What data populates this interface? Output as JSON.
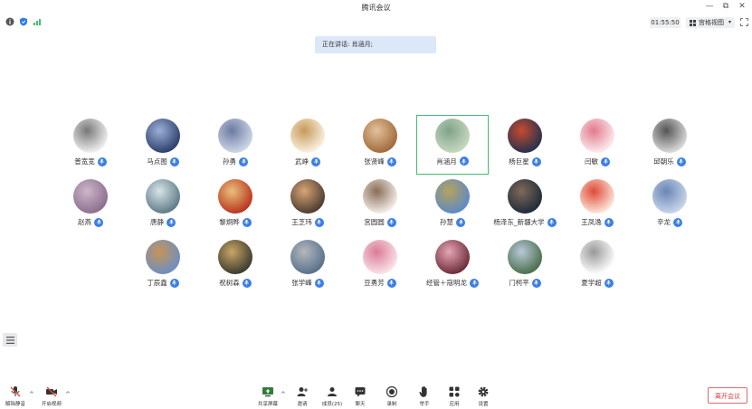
{
  "window": {
    "title": "腾讯会议",
    "minimize": "—",
    "restore": "⧉",
    "close": "✕"
  },
  "status": {
    "timer": "01:55:50",
    "grid_view_label": "宫格视图"
  },
  "speaking": {
    "text": "正在讲话: 肖涵月;"
  },
  "participants": [
    {
      "name": "普宽宽",
      "avatar": "totoro-avatar",
      "colors": [
        "#f2f2f2",
        "#777777"
      ]
    },
    {
      "name": "马点图",
      "avatar": "girl-photo-avatar",
      "colors": [
        "#2c3e6b",
        "#9bb0d8"
      ]
    },
    {
      "name": "孙勇",
      "avatar": "anime-avatar",
      "colors": [
        "#cfd8e8",
        "#6c7aa1"
      ]
    },
    {
      "name": "武峥",
      "avatar": "cartoon-dog-avatar",
      "colors": [
        "#fbf3e4",
        "#c79a5a"
      ]
    },
    {
      "name": "张贤峰",
      "avatar": "bear-avatar",
      "colors": [
        "#a06a3a",
        "#e2c19b"
      ]
    },
    {
      "name": "肖涵月",
      "avatar": "painting-avatar",
      "colors": [
        "#c8d8c0",
        "#7fa38a"
      ]
    },
    {
      "name": "杨巨星",
      "avatar": "dark-landscape-avatar",
      "colors": [
        "#25314d",
        "#c64a2f"
      ]
    },
    {
      "name": "闫敏",
      "avatar": "cartoon-girl-avatar",
      "colors": [
        "#fbeef0",
        "#e37a8d"
      ]
    },
    {
      "name": "邱朝乐",
      "avatar": "forest-avatar",
      "colors": [
        "#dcdcdc",
        "#555555"
      ]
    },
    {
      "name": "赵燕",
      "avatar": "anime-girl-avatar",
      "colors": [
        "#8b6e8f",
        "#cdb6c9"
      ]
    },
    {
      "name": "唐静",
      "avatar": "seal-avatar",
      "colors": [
        "#5e7a86",
        "#d7e4e8"
      ]
    },
    {
      "name": "黎炯晔",
      "avatar": "tiger-avatar",
      "colors": [
        "#b8331e",
        "#e9c07a"
      ]
    },
    {
      "name": "王芝玮",
      "avatar": "girl-avatar",
      "colors": [
        "#4a3b30",
        "#d9a574"
      ]
    },
    {
      "name": "宫圆圆",
      "avatar": "sketch-girl-avatar",
      "colors": [
        "#f5f0ea",
        "#8a6c58"
      ]
    },
    {
      "name": "孙慧",
      "avatar": "grassland-avatar",
      "colors": [
        "#5c89c9",
        "#b6a35a"
      ]
    },
    {
      "name": "杨泽东_新疆大学",
      "avatar": "man-photo-avatar",
      "colors": [
        "#1e2a3a",
        "#7e6a58"
      ]
    },
    {
      "name": "王凤逸",
      "avatar": "crayon-avatar",
      "colors": [
        "#fbe9dc",
        "#e04a3a"
      ]
    },
    {
      "name": "辛龙",
      "avatar": "boy-cartoon-avatar",
      "colors": [
        "#c9d7ea",
        "#6a85b5"
      ]
    },
    {
      "name": "丁辰鑫",
      "avatar": "city-avatar",
      "colors": [
        "#6b8fc4",
        "#c79457"
      ]
    },
    {
      "name": "祝树森",
      "avatar": "dog-photo-avatar",
      "colors": [
        "#3a3a2e",
        "#c8a666"
      ]
    },
    {
      "name": "张学峰",
      "avatar": "people-photo-avatar",
      "colors": [
        "#58708a",
        "#b4b8bd"
      ]
    },
    {
      "name": "豆勇芳",
      "avatar": "girl-illustration-avatar",
      "colors": [
        "#fbe4ea",
        "#d97b96"
      ]
    },
    {
      "name": "经管＋寇明龙",
      "avatar": "couple-avatar",
      "colors": [
        "#6b2b37",
        "#e6a6b4"
      ]
    },
    {
      "name": "门柯平",
      "avatar": "lake-avatar",
      "colors": [
        "#4a6e4c",
        "#b8c9d8"
      ]
    },
    {
      "name": "夏学超",
      "avatar": "coffee-cup-avatar",
      "colors": [
        "#ffffff",
        "#999999"
      ]
    }
  ],
  "toolbar": {
    "unmute": "解除静音",
    "start_video": "开启视频",
    "share_screen": "共享屏幕",
    "invite": "邀请",
    "members": "成员(25)",
    "chat": "聊天",
    "record": "录制",
    "raise_hand": "举手",
    "apps": "应用",
    "settings": "设置",
    "leave": "离开会议"
  }
}
